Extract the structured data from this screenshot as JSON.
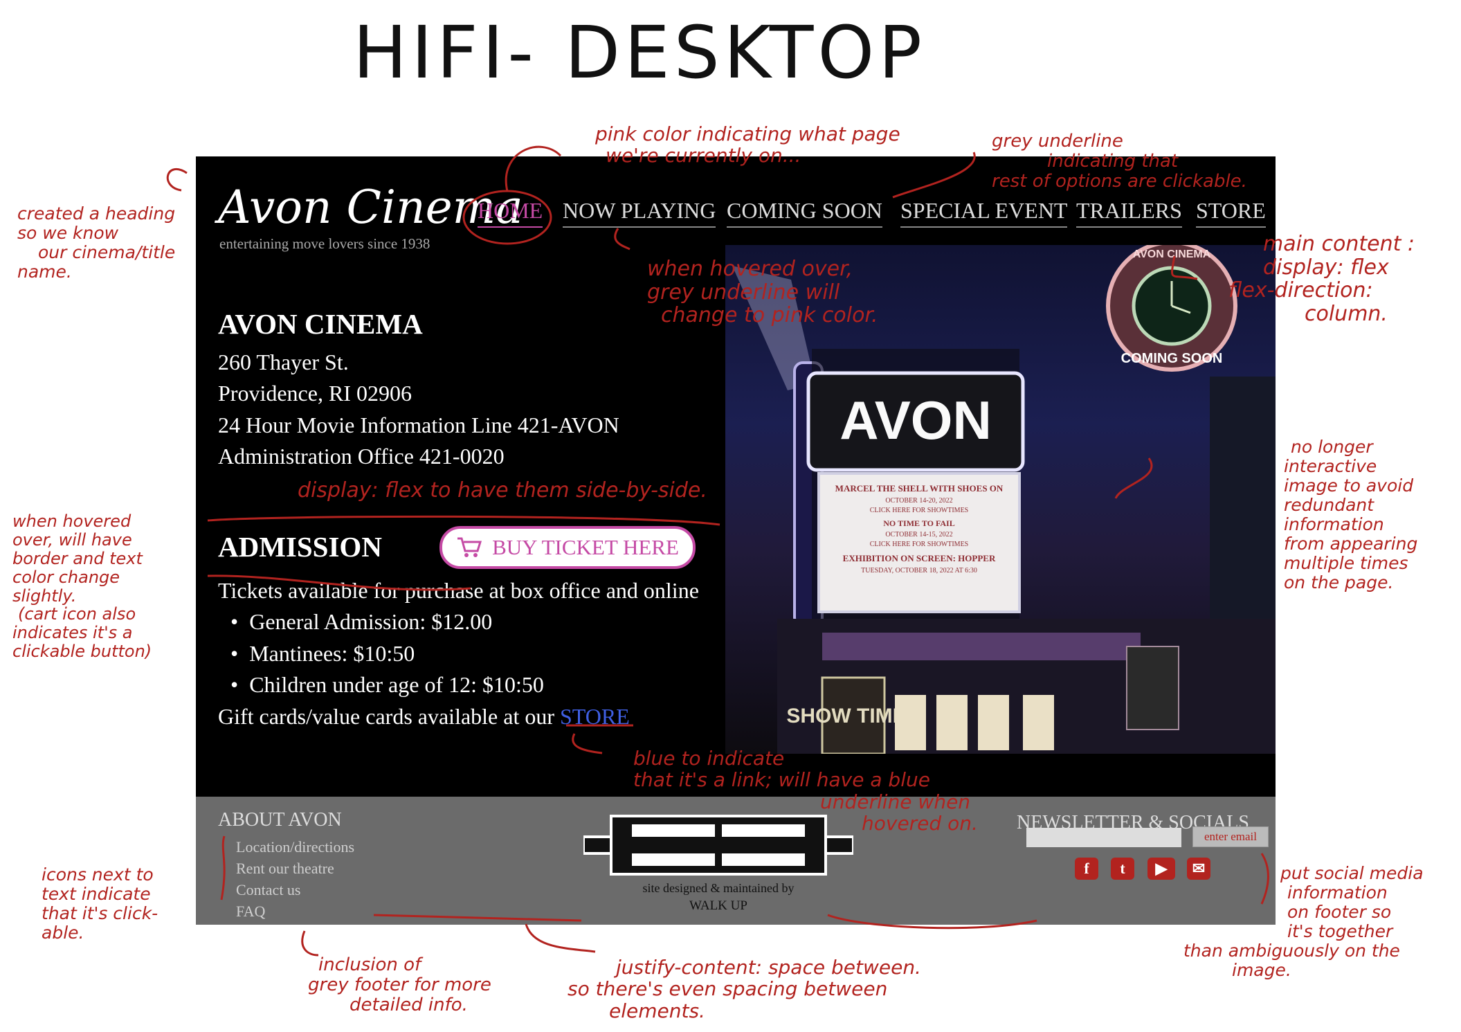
{
  "page_title": "HIFI- DESKTOP",
  "site": {
    "logo": "Avon Cinema",
    "tagline": "entertaining move lovers since 1938",
    "nav": [
      "HOME",
      "NOW PLAYING",
      "COMING SOON",
      "SPECIAL EVENT",
      "TRAILERS",
      "STORE"
    ],
    "active_nav": "HOME",
    "info_heading": "AVON CINEMA",
    "address_lines": [
      "260 Thayer St.",
      "Providence, RI 02906",
      "24 Hour Movie Information Line 421-AVON",
      "Administration Office 421-0020"
    ],
    "admission_heading": "ADMISSION",
    "buy_button": "BUY TICKET HERE",
    "tickets_text": "Tickets available for purchase at box office and online",
    "prices": [
      "General Admission: $12.00",
      "Mantinees: $10:50",
      "Children under age of 12: $10:50"
    ],
    "giftcard_text": "Gift cards/value cards available at our",
    "store_link": "STORE",
    "marquee": {
      "sign": "AVON",
      "lines": [
        "MARCEL THE SHELL WITH SHOES ON",
        "OCTOBER 14-20, 2022",
        "CLICK HERE FOR SHOWTIMES",
        "NO TIME TO FAIL",
        "OCTOBER 14-15, 2022",
        "CLICK HERE FOR SHOWTIMES",
        "EXHIBITION ON SCREEN: HOPPER",
        "TUESDAY, OCTOBER 18, 2022 AT 6:30"
      ],
      "clock_top": "AVON CINEMA",
      "clock_bottom": "COMING SOON",
      "side_text": "SHOW TIMES"
    },
    "footer": {
      "about_heading": "ABOUT AVON",
      "about_links": [
        "Location/directions",
        "Rent our theatre",
        "Contact us",
        "FAQ"
      ],
      "credit": [
        "site designed & maintained by",
        "WALK UP"
      ],
      "newsletter_heading": "NEWSLETTER & SOCIALS",
      "email_button": "enter email",
      "socials": [
        "facebook-icon",
        "twitter-icon",
        "youtube-icon",
        "email-icon"
      ]
    }
  },
  "annotations": {
    "heading_note": [
      "created a heading",
      "so we know",
      "our cinema/title",
      "name."
    ],
    "pink_note": [
      "pink color indicating what page",
      "we're currently on..."
    ],
    "grey_note": [
      "grey underline",
      "indicating that",
      "rest of options are clickable."
    ],
    "hover_note": [
      "when hovered over,",
      "grey underline will",
      "change to pink color."
    ],
    "main_note": [
      "main content :",
      "display: flex",
      "flex-direction:",
      "column."
    ],
    "flex_note": "display: flex to have them side-by-side.",
    "button_note": [
      "when hovered",
      "over, will have",
      "border and text",
      "color change",
      "slightly.",
      "(cart icon also",
      "indicates it's a",
      "clickable button)"
    ],
    "image_note": [
      "no longer",
      "interactive",
      "image to avoid",
      "redundant",
      "information",
      "from appearing",
      "multiple times",
      "on the page."
    ],
    "blue_note": [
      "blue to indicate",
      "that it's a link; will have a blue",
      "underline when",
      "hovered on."
    ],
    "icons_note": [
      "icons next to",
      "text indicate",
      "that it's click-",
      "able."
    ],
    "footer_note": [
      "inclusion of",
      "grey footer for more",
      "detailed info."
    ],
    "justify_note": [
      "justify-content: space between.",
      "so there's even spacing between",
      "elements."
    ],
    "social_note": [
      "put social media",
      "information",
      "on footer so",
      "it's together",
      "than ambiguously on the",
      "image."
    ]
  }
}
